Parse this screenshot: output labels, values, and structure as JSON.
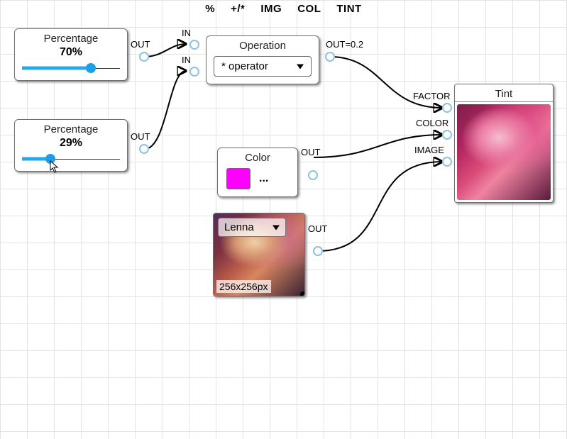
{
  "toolbar": {
    "items": [
      "%",
      "+/*",
      "IMG",
      "COL",
      "TINT"
    ]
  },
  "nodes": {
    "pct1": {
      "title": "Percentage",
      "value": "70%",
      "percent": 70
    },
    "pct2": {
      "title": "Percentage",
      "value": "29%",
      "percent": 29
    },
    "operation": {
      "title": "Operation",
      "selected": "* operator"
    },
    "color": {
      "title": "Color",
      "hex": "#ff00ff",
      "button": "..."
    },
    "image": {
      "source": "Lenna",
      "caption": "256x256px"
    },
    "tint": {
      "title": "Tint"
    }
  },
  "ports": {
    "pct1_out": "OUT",
    "pct2_out": "OUT",
    "op_in1": "IN",
    "op_in2": "IN",
    "op_out": "OUT=0.2",
    "color_out": "OUT",
    "image_out": "OUT",
    "tint_factor": "FACTOR",
    "tint_color": "COLOR",
    "tint_image": "IMAGE"
  }
}
